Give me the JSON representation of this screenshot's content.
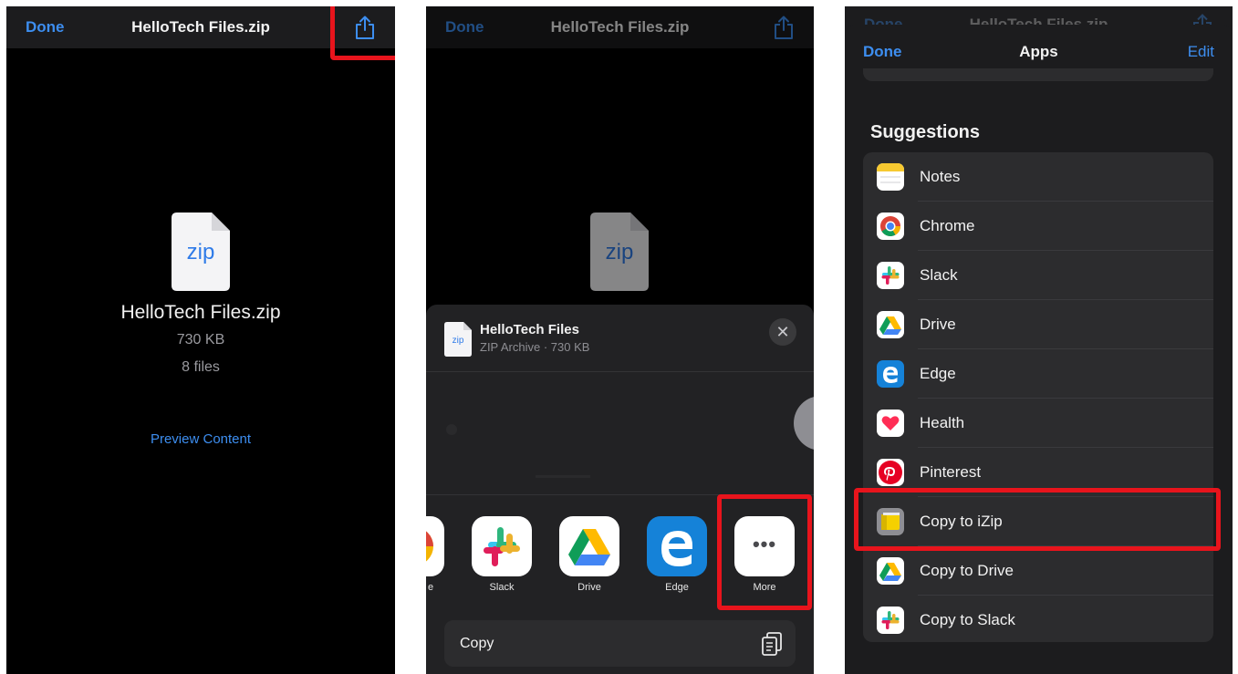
{
  "panel1": {
    "nav": {
      "done": "Done",
      "title": "HelloTech Files.zip"
    },
    "file_icon_label": "zip",
    "file_name": "HelloTech Files.zip",
    "file_size": "730 KB",
    "file_count": "8 files",
    "preview_link": "Preview Content"
  },
  "panel2": {
    "nav": {
      "done": "Done",
      "title": "HelloTech Files.zip"
    },
    "file_icon_label": "zip",
    "sheet": {
      "icon_label": "zip",
      "title": "HelloTech Files",
      "subtitle": "ZIP Archive · 730 KB",
      "close_glyph": "✕"
    },
    "apps": [
      {
        "label": "e"
      },
      {
        "label": "Slack"
      },
      {
        "label": "Drive"
      },
      {
        "label": "Edge"
      },
      {
        "label": "More"
      }
    ],
    "more_glyph": "•••",
    "copy_label": "Copy"
  },
  "panel3": {
    "behind_nav": {
      "done": "Done",
      "title": "HelloTech Files.zip"
    },
    "nav": {
      "done": "Done",
      "title": "Apps",
      "edit": "Edit"
    },
    "section_title": "Suggestions",
    "items": [
      {
        "label": "Notes",
        "icon": "notes-icon"
      },
      {
        "label": "Chrome",
        "icon": "chrome-icon"
      },
      {
        "label": "Slack",
        "icon": "slack-icon"
      },
      {
        "label": "Drive",
        "icon": "drive-icon"
      },
      {
        "label": "Edge",
        "icon": "edge-icon"
      },
      {
        "label": "Health",
        "icon": "health-icon"
      },
      {
        "label": "Pinterest",
        "icon": "pinterest-icon"
      },
      {
        "label": "Copy to iZip",
        "icon": "izip-icon"
      },
      {
        "label": "Copy to Drive",
        "icon": "drive-icon"
      },
      {
        "label": "Copy to Slack",
        "icon": "slack-icon"
      }
    ]
  },
  "colors": {
    "ios_blue": "#3d8ef0",
    "highlight_red": "#e8141c",
    "zip_blue": "#2f7be8"
  }
}
